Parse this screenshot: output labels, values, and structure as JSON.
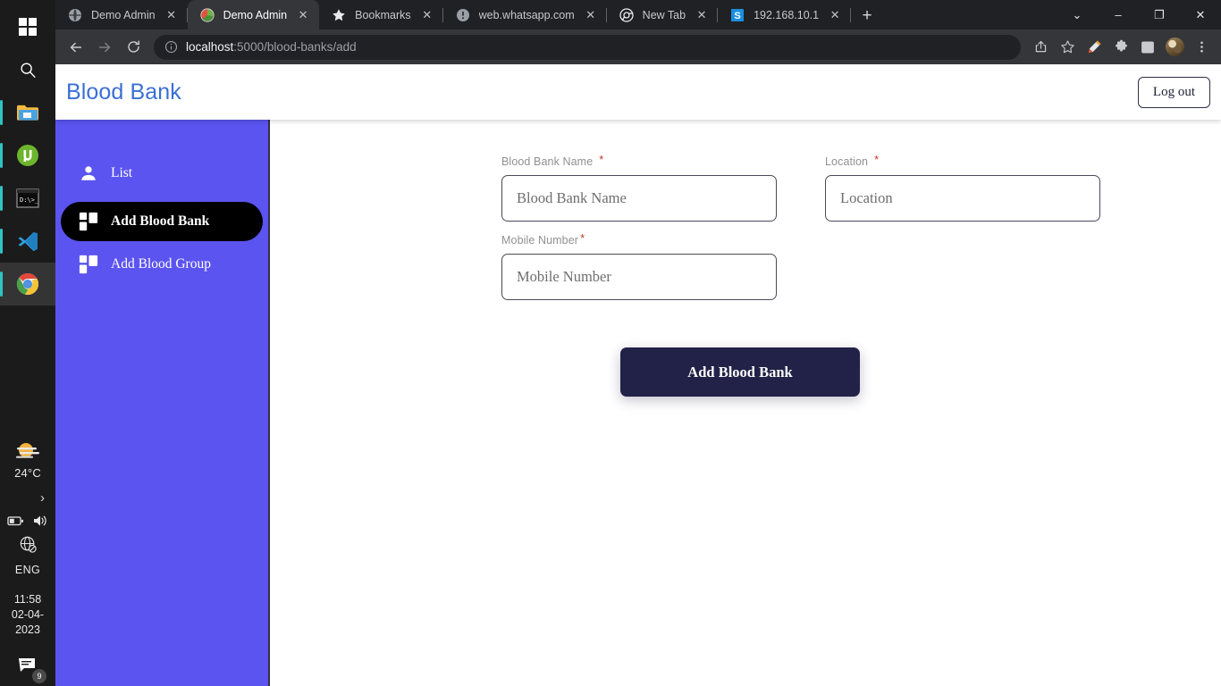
{
  "taskbar": {
    "icons": [
      {
        "name": "windows-start-icon",
        "label": "Start"
      },
      {
        "name": "search-icon",
        "label": "Search"
      },
      {
        "name": "file-explorer-icon",
        "label": "File Explorer"
      },
      {
        "name": "utorrent-icon",
        "label": "uTorrent"
      },
      {
        "name": "terminal-icon",
        "label": "Command Prompt"
      },
      {
        "name": "vscode-icon",
        "label": "Visual Studio Code"
      },
      {
        "name": "chrome-icon",
        "label": "Google Chrome"
      }
    ],
    "weather_temp": "24°C",
    "weather_icon": "sun-haze-icon",
    "overflow_icon": "chevron-up-icon",
    "battery_icon": "battery-icon",
    "volume_icon": "speaker-icon",
    "network_icon": "globe-blocked-icon",
    "language": "ENG",
    "time": "11:58",
    "date": "02-04-2023",
    "notification_icon": "notification-icon",
    "notification_count": "9"
  },
  "browser": {
    "tabs": [
      {
        "title": "Demo Admin",
        "favicon": "globe-gray-icon",
        "active": false,
        "close_label": "✕"
      },
      {
        "title": "Demo Admin",
        "favicon": "colorful-circle-icon",
        "active": true,
        "close_label": "✕"
      },
      {
        "title": "Bookmarks",
        "favicon": "star-icon",
        "active": false,
        "close_label": "✕"
      },
      {
        "title": "web.whatsapp.com",
        "favicon": "exclamation-circle-icon",
        "active": false,
        "close_label": "✕"
      },
      {
        "title": "New Tab",
        "favicon": "chrome-icon",
        "active": false,
        "close_label": "✕"
      },
      {
        "title": "192.168.10.1",
        "favicon": "blue-s-icon",
        "active": false,
        "close_label": "✕"
      }
    ],
    "new_tab_label": "+",
    "window_controls": [
      {
        "name": "tab-search-button",
        "glyph": "⌄"
      },
      {
        "name": "minimize-button",
        "glyph": "–"
      },
      {
        "name": "maximize-button",
        "glyph": "❐"
      },
      {
        "name": "close-window-button",
        "glyph": "✕"
      }
    ],
    "nav": {
      "back_icon": "arrow-left-icon",
      "forward_icon": "arrow-right-icon",
      "reload_icon": "reload-icon"
    },
    "omnibox": {
      "info_icon": "info-circle-icon",
      "url_host": "localhost",
      "url_path": ":5000/blood-banks/add"
    },
    "actions": [
      {
        "name": "share-icon"
      },
      {
        "name": "bookmark-star-icon"
      },
      {
        "name": "highlighter-pen-icon"
      },
      {
        "name": "extensions-puzzle-icon"
      },
      {
        "name": "side-panel-icon"
      },
      {
        "name": "profile-avatar"
      },
      {
        "name": "chrome-menu-icon"
      }
    ]
  },
  "app": {
    "brand": "Blood Bank",
    "logout_label": "Log out",
    "sidebar": [
      {
        "label": "List",
        "icon": "person-icon",
        "active": false
      },
      {
        "label": "Add Blood Bank",
        "icon": "dashboard-grid-icon",
        "active": true
      },
      {
        "label": "Add Blood Group",
        "icon": "dashboard-grid-icon",
        "active": false
      }
    ],
    "form": {
      "fields": [
        {
          "label": "Blood Bank Name",
          "required": "*",
          "placeholder": "Blood Bank Name",
          "value": ""
        },
        {
          "label": "Location",
          "required": "*",
          "placeholder": "Location",
          "value": ""
        },
        {
          "label": "Mobile Number",
          "required": "*",
          "placeholder": "Mobile Number",
          "value": ""
        }
      ],
      "submit_label": "Add Blood Bank"
    }
  },
  "colors": {
    "sidebar": "#5b54f0",
    "brand_blue": "#3b6fd4",
    "submit_navy": "#222248",
    "required_red": "#c0392b",
    "taskbar": "#1b1b1b",
    "chrome_tabstrip": "#202124",
    "chrome_toolbar": "#35363a"
  }
}
